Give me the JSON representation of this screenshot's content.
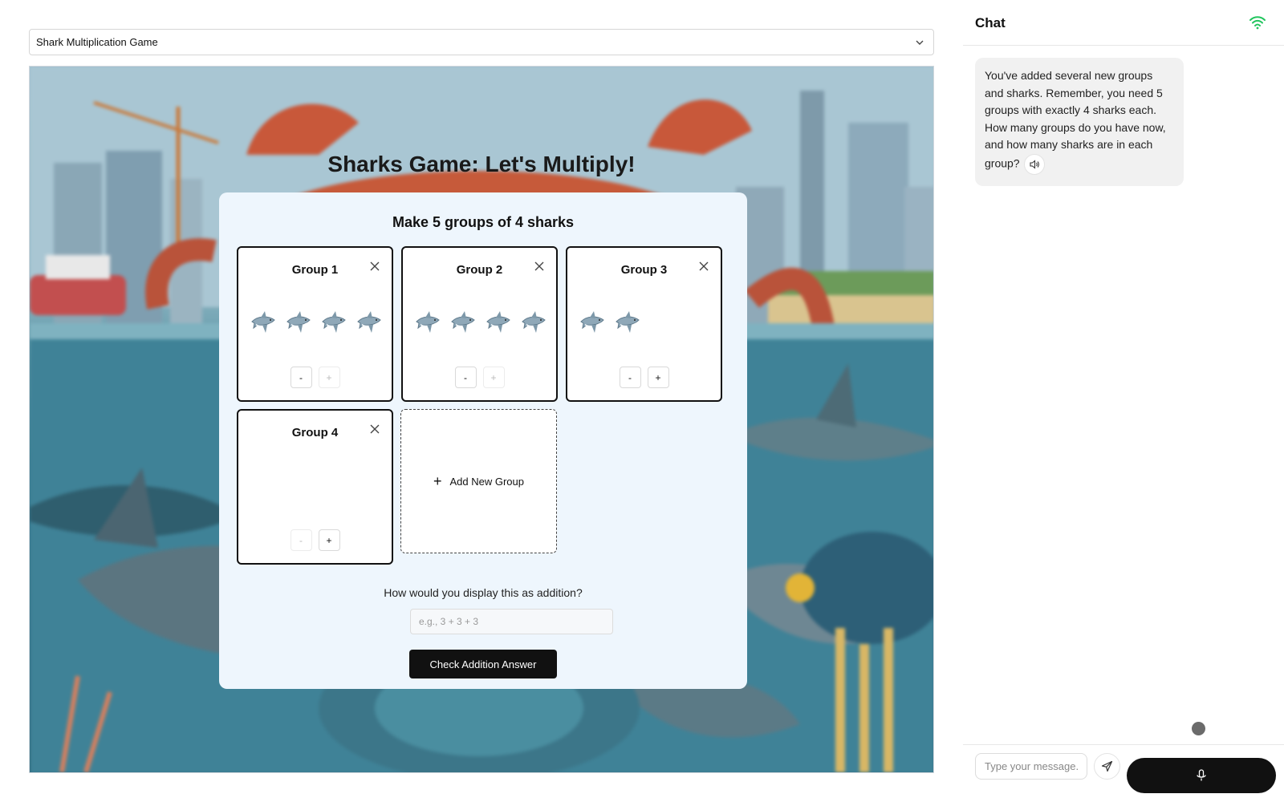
{
  "game_select": {
    "selected": "Shark Multiplication Game"
  },
  "game": {
    "title": "Sharks Game: Let's Multiply!",
    "prompt": "Make 5 groups of 4 sharks",
    "groups": [
      {
        "label": "Group 1",
        "sharks": 4,
        "minus": "-",
        "plus": "+"
      },
      {
        "label": "Group 2",
        "sharks": 4,
        "minus": "-",
        "plus": "+"
      },
      {
        "label": "Group 3",
        "sharks": 2,
        "minus": "-",
        "plus": "+"
      },
      {
        "label": "Group 4",
        "sharks": 0,
        "minus": "-",
        "plus": "+"
      }
    ],
    "add_group": {
      "icon": "+",
      "label": "Add New Group"
    },
    "addition_question": "How would you display this as addition?",
    "addition_placeholder": "e.g., 3 + 3 + 3",
    "check_button": "Check Addition Answer"
  },
  "chat": {
    "title": "Chat",
    "status_icon": "wifi-icon",
    "status_color": "#22c55e",
    "messages": [
      {
        "text": "You've added several new groups and sharks. Remember, you need 5 groups with exactly 4 sharks each. How many groups do you have now, and how many sharks are in each group?"
      }
    ],
    "input_placeholder": "Type your message..",
    "icons": {
      "send": "send-icon",
      "mic": "microphone-icon",
      "speaker": "speaker-icon"
    }
  }
}
